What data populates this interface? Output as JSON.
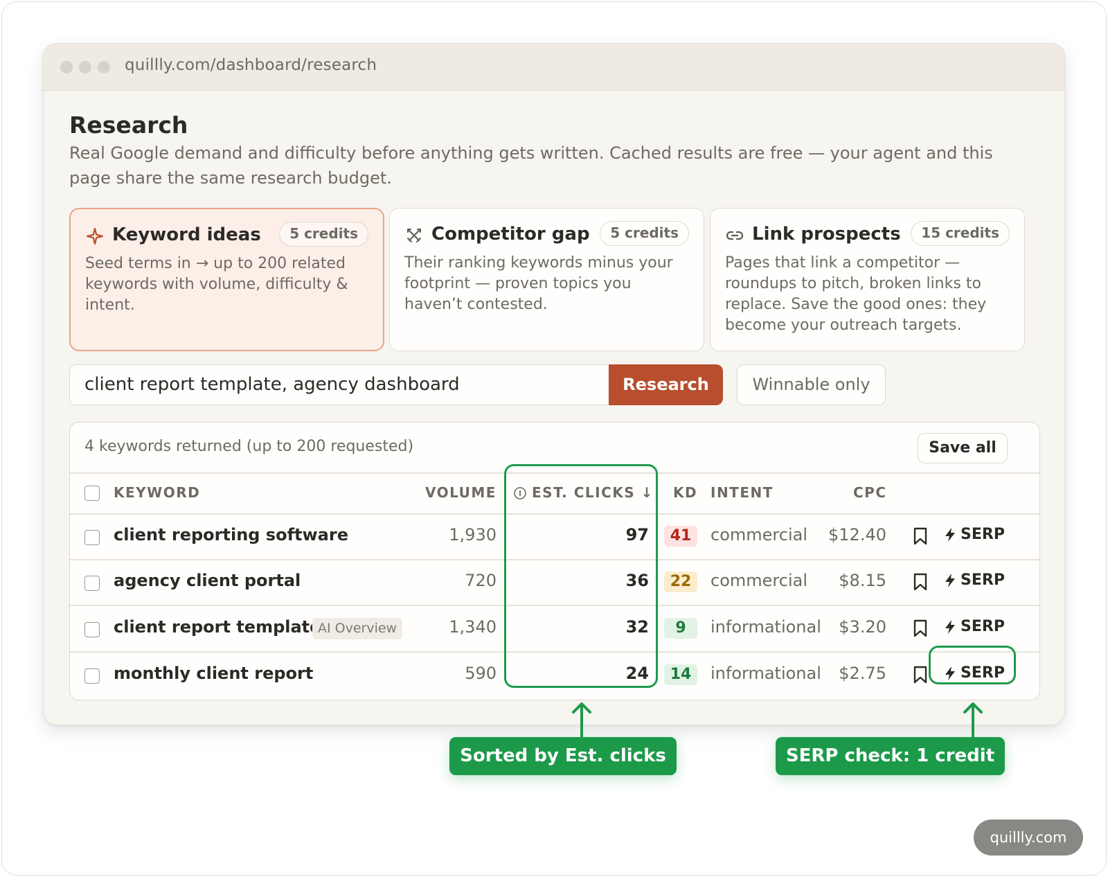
{
  "browser": {
    "url": "quillly.com/dashboard/research"
  },
  "page": {
    "title": "Research",
    "description": "Real Google demand and difficulty before anything gets written. Cached results are free — your agent and this page share the same research budget."
  },
  "cards": [
    {
      "title": "Keyword ideas",
      "credits": "5 credits",
      "description": "Seed terms in → up to 200 related keywords with volume, difficulty & intent.",
      "icon": "sparkle-icon",
      "active": true
    },
    {
      "title": "Competitor gap",
      "credits": "5 credits",
      "description": "Their ranking keywords minus your footprint — proven topics you haven’t contested.",
      "icon": "swords-icon",
      "active": false
    },
    {
      "title": "Link prospects",
      "credits": "15 credits",
      "description": "Pages that link a competitor — roundups to pitch, broken links to replace. Save the good ones: they become your outreach targets.",
      "icon": "link-icon",
      "active": false
    }
  ],
  "search": {
    "value": "client report template, agency dashboard",
    "button": "Research",
    "filter_button": "Winnable only"
  },
  "results": {
    "summary": "4 keywords returned (up to 200 requested)",
    "save_all": "Save all",
    "columns": {
      "keyword": "KEYWORD",
      "volume": "VOLUME",
      "clicks": "EST. CLICKS ↓",
      "kd": "KD",
      "intent": "INTENT",
      "cpc": "CPC"
    },
    "rows": [
      {
        "keyword": "client reporting software",
        "badge": "",
        "volume": "1,930",
        "clicks": "97",
        "kd": "41",
        "kd_level": "hard",
        "intent": "commercial",
        "cpc": "$12.40",
        "serp": "SERP"
      },
      {
        "keyword": "agency client portal",
        "badge": "",
        "volume": "720",
        "clicks": "36",
        "kd": "22",
        "kd_level": "medium",
        "intent": "commercial",
        "cpc": "$8.15",
        "serp": "SERP"
      },
      {
        "keyword": "client report template",
        "badge": "AI Overview",
        "volume": "1,340",
        "clicks": "32",
        "kd": "9",
        "kd_level": "easy",
        "intent": "informational",
        "cpc": "$3.20",
        "serp": "SERP"
      },
      {
        "keyword": "monthly client report",
        "badge": "",
        "volume": "590",
        "clicks": "24",
        "kd": "14",
        "kd_level": "easy",
        "intent": "informational",
        "cpc": "$2.75",
        "serp": "SERP"
      }
    ]
  },
  "callouts": {
    "sorted": "Sorted by Est. clicks",
    "serp": "SERP check: 1 credit"
  },
  "watermark": "quillly.com",
  "colors": {
    "accent": "#b84e2e",
    "callout_green": "#1c9a4a",
    "kd_hard_bg": "#fbe3e1",
    "kd_hard_fg": "#b3261e",
    "kd_medium_bg": "#fbeccc",
    "kd_medium_fg": "#9a6a00",
    "kd_easy_bg": "#e2f3e6",
    "kd_easy_fg": "#1e7b3c"
  }
}
